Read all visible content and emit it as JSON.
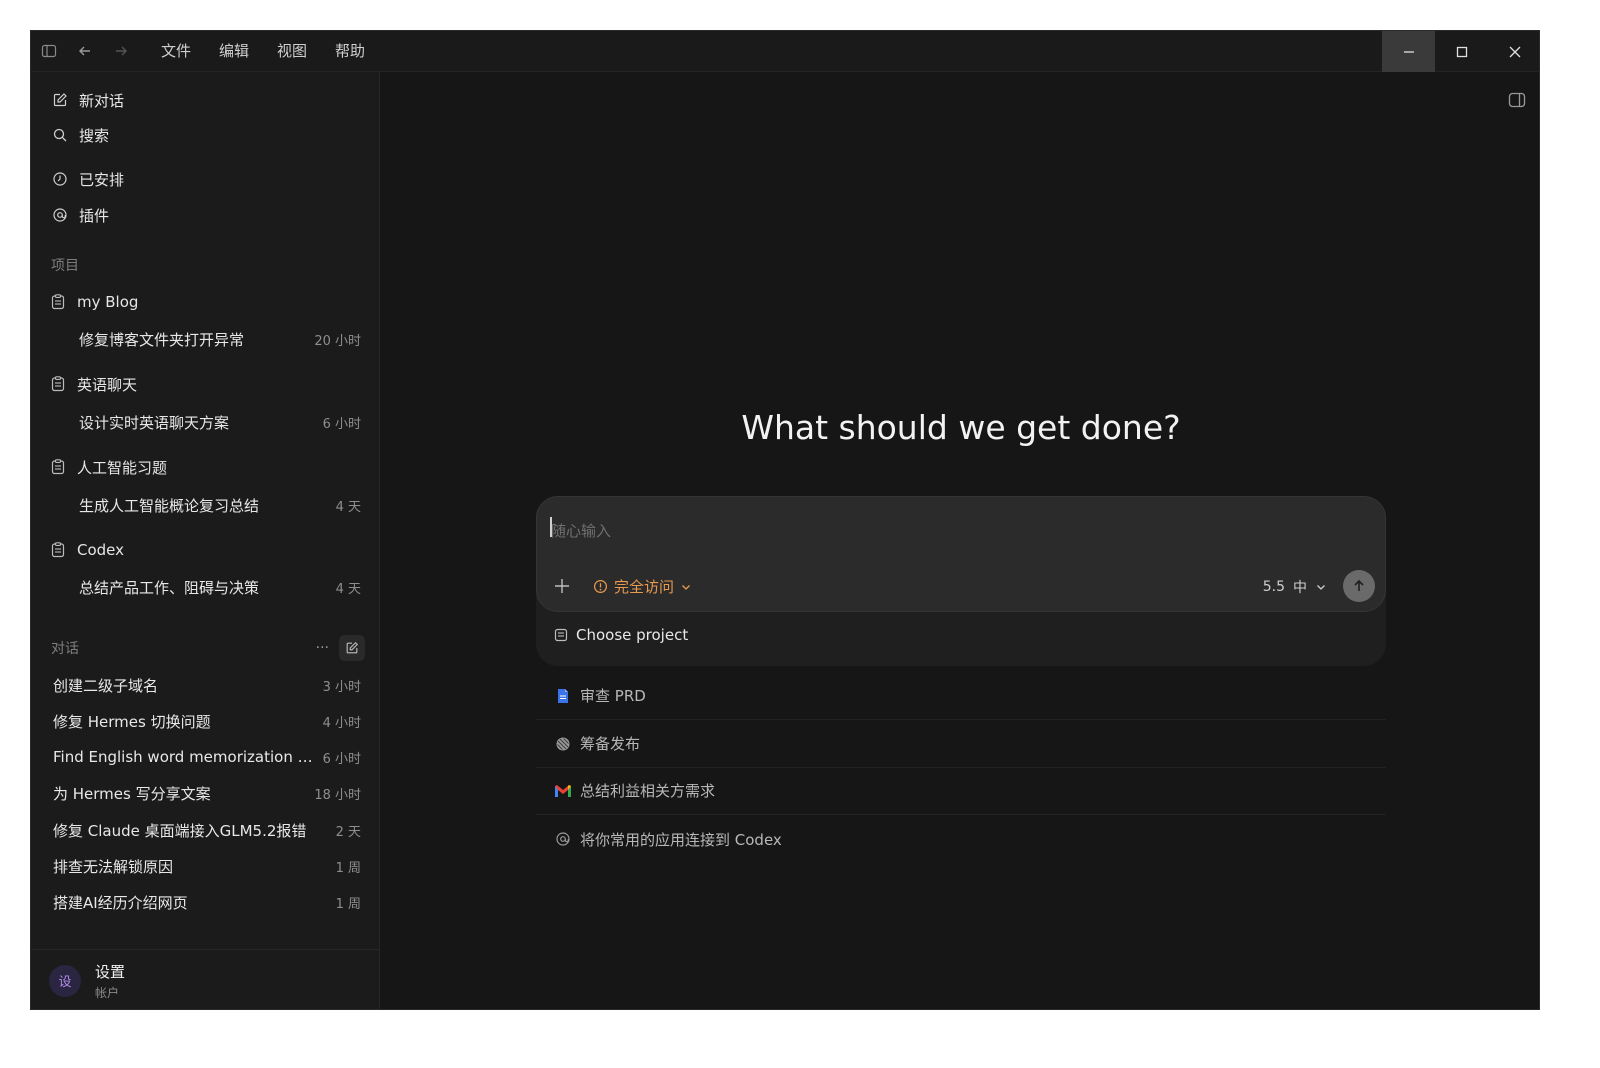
{
  "menu": [
    "文件",
    "编辑",
    "视图",
    "帮助"
  ],
  "sidebar": {
    "nav": [
      {
        "label": "新对话",
        "icon": "edit-icon"
      },
      {
        "label": "搜索",
        "icon": "search-icon"
      },
      {
        "label": "已安排",
        "icon": "clock-icon"
      },
      {
        "label": "插件",
        "icon": "at-icon"
      }
    ],
    "projects_label": "项目",
    "projects": [
      {
        "name": "my Blog",
        "thread": "修复博客文件夹打开异常",
        "time": "20 小时"
      },
      {
        "name": "英语聊天",
        "thread": "设计实时英语聊天方案",
        "time": "6 小时"
      },
      {
        "name": "人工智能习题",
        "thread": "生成人工智能概论复习总结",
        "time": "4 天"
      },
      {
        "name": "Codex",
        "thread": "总结产品工作、阻碍与决策",
        "time": "4 天"
      }
    ],
    "conversations_label": "对话",
    "conversations_more": "···",
    "conversations": [
      {
        "title": "创建二级子域名",
        "time": "3 小时"
      },
      {
        "title": "修复 Hermes 切换问题",
        "time": "4 小时"
      },
      {
        "title": "Find English word memorization t...",
        "time": "6 小时"
      },
      {
        "title": "为 Hermes 写分享文案",
        "time": "18 小时"
      },
      {
        "title": "修复 Claude 桌面端接入GLM5.2报错",
        "time": "2 天"
      },
      {
        "title": "排查无法解锁原因",
        "time": "1 周"
      },
      {
        "title": "搭建AI经历介绍网页",
        "time": "1 周"
      }
    ],
    "user": {
      "avatar": "设",
      "name": "设置",
      "sub": "帐户"
    }
  },
  "main": {
    "heading": "What should we get done?",
    "composer": {
      "placeholder": "随心输入",
      "plus": "+",
      "access_label": "完全访问",
      "model_version": "5.5",
      "model_effort": "中",
      "choose_project": "Choose project"
    },
    "suggestions": [
      {
        "label": "审查 PRD",
        "icon": "doc-icon"
      },
      {
        "label": "筹备发布",
        "icon": "rocket-icon"
      },
      {
        "label": "总结利益相关方需求",
        "icon": "gmail-icon"
      },
      {
        "label": "将你常用的应用连接到 Codex",
        "icon": "at-icon"
      }
    ]
  },
  "colors": {
    "accent_access": "#e89a4f",
    "background": "#161616",
    "sidebar": "#1b1b1b"
  }
}
